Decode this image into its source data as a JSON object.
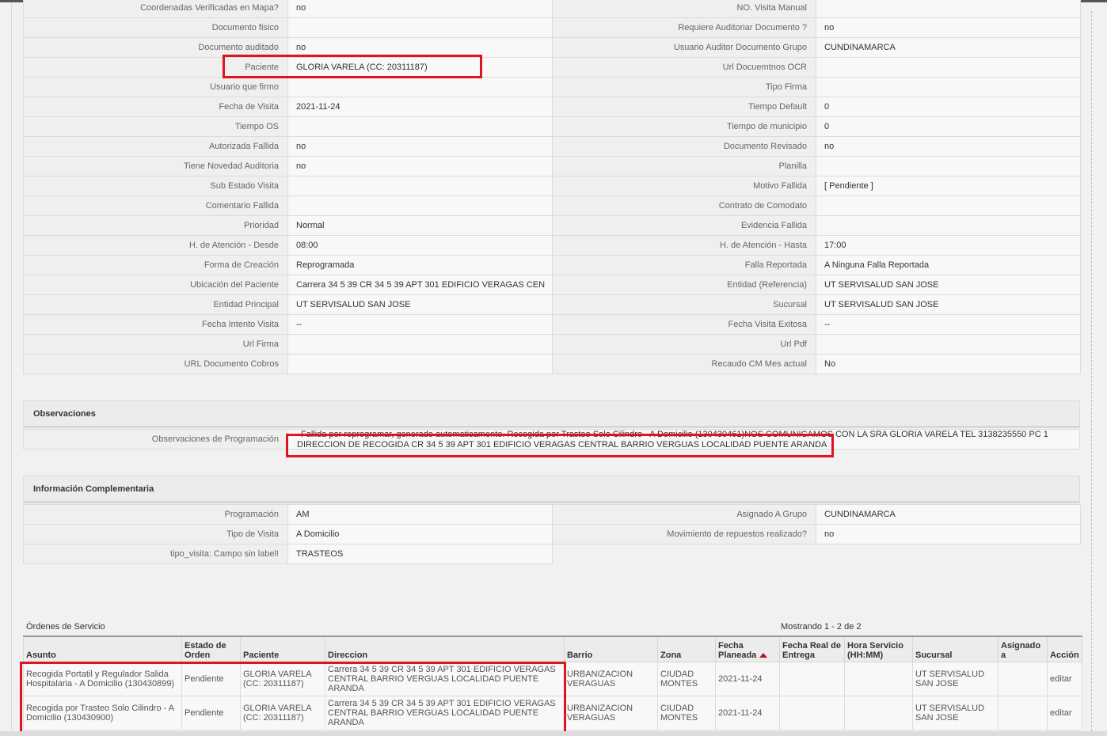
{
  "detalle": [
    [
      "Coordenadas Verificadas en Mapa?",
      "no",
      "NO. Visita Manual",
      ""
    ],
    [
      "Documento fisico",
      "",
      "Requiere Auditoriar Documento ?",
      "no"
    ],
    [
      "Documento auditado",
      "no",
      "Usuario Auditor Documento Grupo",
      "CUNDINAMARCA"
    ],
    [
      "Paciente",
      "GLORIA VARELA (CC: 20311187)",
      "Url Docuemtnos OCR",
      ""
    ],
    [
      "Usuario que firmo",
      "",
      "Tipo Firma",
      ""
    ],
    [
      "Fecha de Visita",
      "2021-11-24",
      "Tiempo Default",
      "0"
    ],
    [
      "Tiempo OS",
      "",
      "Tiempo de municipio",
      "0"
    ],
    [
      "Autorizada Fallida",
      "no",
      "Documento Revisado",
      "no"
    ],
    [
      "Tiene Novedad Auditoria",
      "no",
      "Planilla",
      ""
    ],
    [
      "Sub Estado Visita",
      "",
      "Motivo Fallida",
      "[ Pendiente ]"
    ],
    [
      "Comentario Fallida",
      "",
      "Contrato de Comodato",
      ""
    ],
    [
      "Prioridad",
      "Normal",
      "Evidencia Fallida",
      ""
    ],
    [
      "H. de Atención - Desde",
      "08:00",
      "H. de Atención - Hasta",
      "17:00"
    ],
    [
      "Forma de Creación",
      "Reprogramada",
      "Falla Reportada",
      "A Ninguna Falla Reportada"
    ],
    [
      "Ubicación del Paciente",
      "Carrera 34 5 39 CR 34 5 39 APT 301 EDIFICIO VERAGAS CEN",
      "Entidad (Referencia)",
      "UT SERVISALUD SAN JOSE"
    ],
    [
      "Entidad Principal",
      "UT SERVISALUD SAN JOSE",
      "Sucursal",
      "UT SERVISALUD SAN JOSE"
    ],
    [
      "Fecha Intento Visita",
      "--",
      "Fecha Visita Exitosa",
      "--"
    ],
    [
      "Url Firma",
      "",
      "Url Pdf",
      ""
    ],
    [
      "URL Documento Cobros",
      "",
      "Recaudo CM Mes actual",
      "No"
    ]
  ],
  "observaciones": {
    "title": "Observaciones",
    "label": "Observaciones de Programación",
    "line1": "Fallida por reprogramar, generado automaticamente. Recogida por Trasteo Solo Cilindro - A Domicilio (130430461)NOS COMUNICAMOS CON LA SRA GLORIA VARELA TEL 3138235550 PC 1",
    "line2": "DIRECCION DE RECOGIDA CR 34 5 39 APT 301 EDIFICIO VERAGAS CENTRAL BARRIO VERGUAS LOCALIDAD PUENTE ARANDA"
  },
  "complementaria": {
    "title": "Información Complementaria",
    "rows": [
      [
        "Programación",
        "AM",
        "Asignado A Grupo",
        "CUNDINAMARCA"
      ],
      [
        "Tipo de Visita",
        "A Domicilio",
        "Movimiento de repuestos realizado?",
        "no"
      ],
      [
        "tipo_visita: Campo sin label!",
        "TRASTEOS"
      ]
    ]
  },
  "ordenes": {
    "title": "Órdenes de Servicio",
    "count": "Mostrando 1 - 2 de 2",
    "headers": [
      "Asunto",
      "Estado de Orden",
      "Paciente",
      "Direccion",
      "Barrio",
      "Zona",
      "Fecha Planeada",
      "Fecha Real de Entrega",
      "Hora Servicio (HH:MM)",
      "Sucursal",
      "Asignado a",
      "Acción"
    ],
    "rows": [
      [
        "Recogida Portatil y Regulador Salida Hospitalaria - A Domicilio (130430899)",
        "Pendiente",
        "GLORIA VARELA (CC: 20311187)",
        "Carrera 34 5 39 CR 34 5 39 APT 301 EDIFICIO VERAGAS CENTRAL BARRIO VERGUAS LOCALIDAD PUENTE ARANDA",
        "URBANIZACION VERAGUAS",
        "CIUDAD MONTES",
        "2021-11-24",
        "",
        "",
        "UT SERVISALUD SAN JOSE",
        "",
        "editar"
      ],
      [
        "Recogida por Trasteo Solo Cilindro - A Domicilio (130430900)",
        "Pendiente",
        "GLORIA VARELA (CC: 20311187)",
        "Carrera 34 5 39 CR 34 5 39 APT 301 EDIFICIO VERAGAS CENTRAL BARRIO VERGUAS LOCALIDAD PUENTE ARANDA",
        "URBANIZACION VERAGUAS",
        "CIUDAD MONTES",
        "2021-11-24",
        "",
        "",
        "UT SERVISALUD SAN JOSE",
        "",
        "editar"
      ]
    ]
  },
  "colors": {
    "highlight": "#e0141e",
    "sort_arrow": "#c0121b"
  }
}
